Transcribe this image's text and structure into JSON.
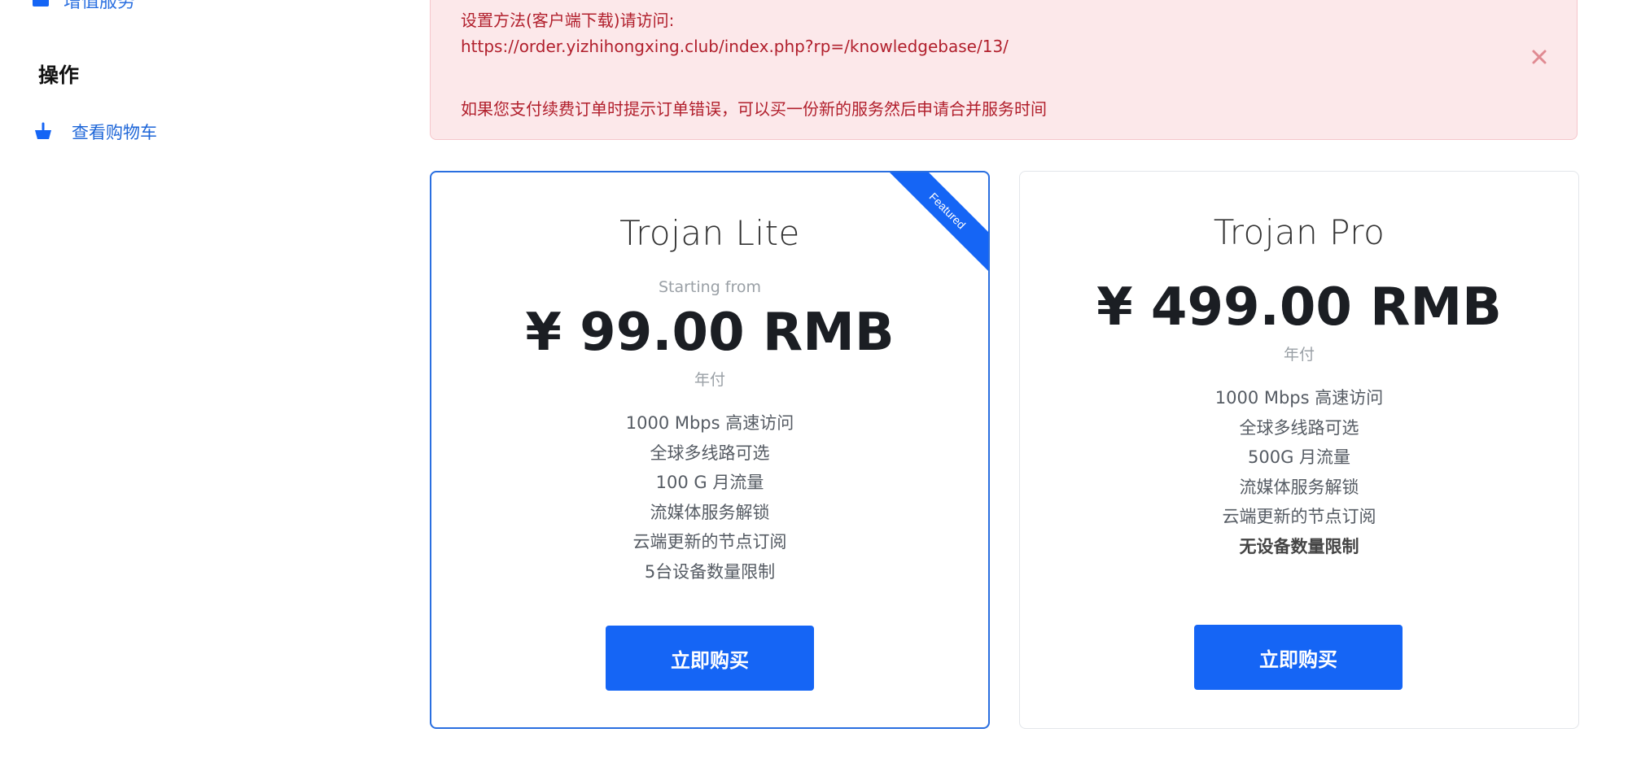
{
  "sidebar": {
    "partial_item_label": "增值服务",
    "heading": "操作",
    "cart_link": "查看购物车"
  },
  "alert": {
    "line1": "设置方法(客户端下载)请访问:",
    "line2": "https://order.yizhihongxing.club/index.php?rp=/knowledgebase/13/",
    "line3": "如果您支付续费订单时提示订单错误，可以买一份新的服务然后申请合并服务时间"
  },
  "plans": [
    {
      "name": "Trojan Lite",
      "ribbon": "Featured",
      "starting_label": "Starting from",
      "price": "¥ 99.00 RMB",
      "cycle": "年付",
      "features": [
        "1000 Mbps 高速访问",
        "全球多线路可选",
        "100 G 月流量",
        "流媒体服务解锁",
        "云端更新的节点订阅",
        "5台设备数量限制"
      ],
      "button": "立即购买"
    },
    {
      "name": "Trojan Pro",
      "price": "¥ 499.00 RMB",
      "cycle": "年付",
      "features": [
        "1000 Mbps 高速访问",
        "全球多线路可选",
        "500G 月流量",
        "流媒体服务解锁",
        "云端更新的节点订阅",
        "无设备数量限制"
      ],
      "button": "立即购买"
    }
  ],
  "colors": {
    "accent": "#1565f5",
    "alert_bg": "#fce8ea",
    "alert_text": "#b11f2c"
  },
  "icons": {
    "sidebar_partial": "square-icon",
    "cart": "basket-icon",
    "alert_close": "close-icon"
  }
}
